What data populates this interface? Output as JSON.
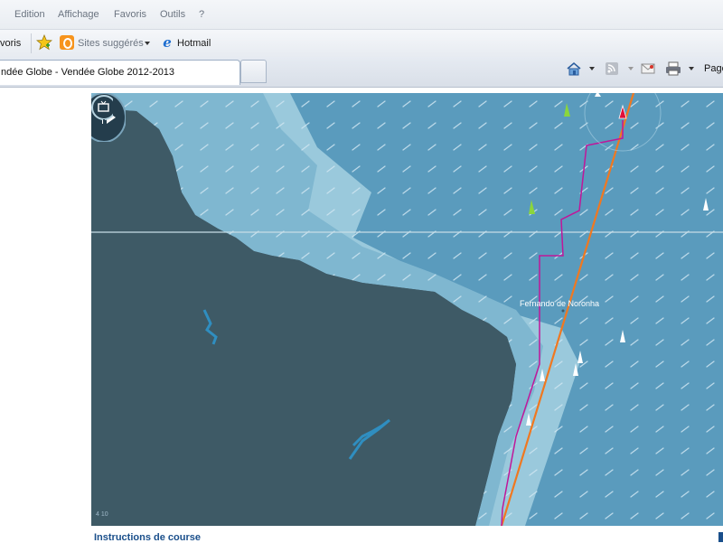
{
  "menu": {
    "items": [
      "Edition",
      "Affichage",
      "Favoris",
      "Outils",
      "?"
    ]
  },
  "favorites_bar": {
    "favorites_label": "voris",
    "suggested_sites": "Sites suggérés",
    "hotmail": "Hotmail"
  },
  "tabs": {
    "active_title": "ndée Globe - Vendée Globe 2012-2013"
  },
  "command_bar": {
    "page_label": "Page"
  },
  "map": {
    "island_label": "Fernando de Noronha",
    "corner_text": "4 10",
    "colors": {
      "land": "#3e5a66",
      "shallow": "#9ac9dc",
      "mid_shallow": "#7fb7d0",
      "ocean": "#5a9bbd",
      "route": "#f07820",
      "track": "#c0179a",
      "boat_green": "#8bd63c",
      "boat_red": "#e0103a"
    }
  },
  "footer": {
    "link": "Instructions de course"
  }
}
